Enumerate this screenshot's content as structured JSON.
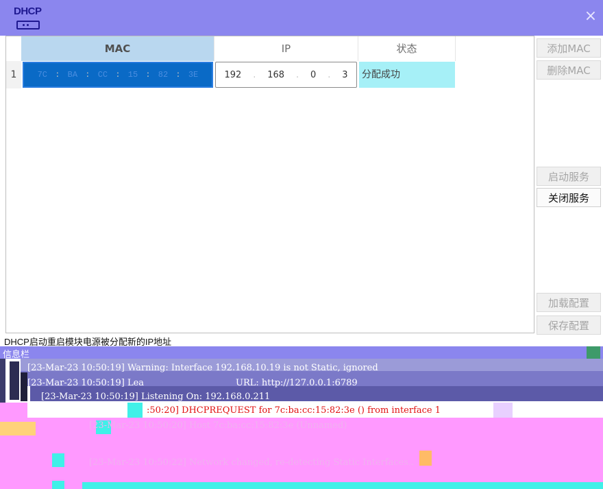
{
  "window": {
    "title": "DHCP",
    "close_glyph": "×"
  },
  "table": {
    "headers": {
      "mac": "MAC",
      "ip": "IP",
      "status": "状态"
    },
    "rows": [
      {
        "index": "1",
        "mac": [
          "7C",
          "BA",
          "CC",
          "15",
          "82",
          "3E"
        ],
        "ip": [
          "192",
          "168",
          "0",
          "3"
        ],
        "status": "分配成功"
      }
    ]
  },
  "buttons": {
    "add_mac": "添加MAC",
    "delete_mac": "删除MAC",
    "start_service": "启动服务",
    "stop_service": "关闭服务",
    "load_config": "加载配置",
    "save_config": "保存配置"
  },
  "status_line": "DHCP启动重启模块电源被分配新的IP地址",
  "info_panel": {
    "title": "信息栏",
    "logs": [
      "[23-Mar-23 10:50:19] Warning: Interface 192.168.10.19 is not Static, ignored",
      "[23-Mar-23 10:50:19] Lea",
      "URL: http://127.0.0.1:6789",
      "[23-Mar-23 10:50:19] Listening On: 192.168.0.211",
      ":50:20] DHCPREQUEST for 7c:ba:cc:15:82:3e () from interface 1",
      "[23-Mar-23 10:50:20] Host 7c:ba:cc:15:82:3e (Unnamed)",
      "[23-Mar-23 10:50:22] Network changed, re-detecting Static Interfaces.."
    ]
  },
  "colors": {
    "titlebar": "#8b86ee",
    "mac_selected": "#0a6ac6",
    "status_cell": "#a6f0f7",
    "log_magenta": "#ff99ff",
    "log_request_red": "#e01010"
  }
}
